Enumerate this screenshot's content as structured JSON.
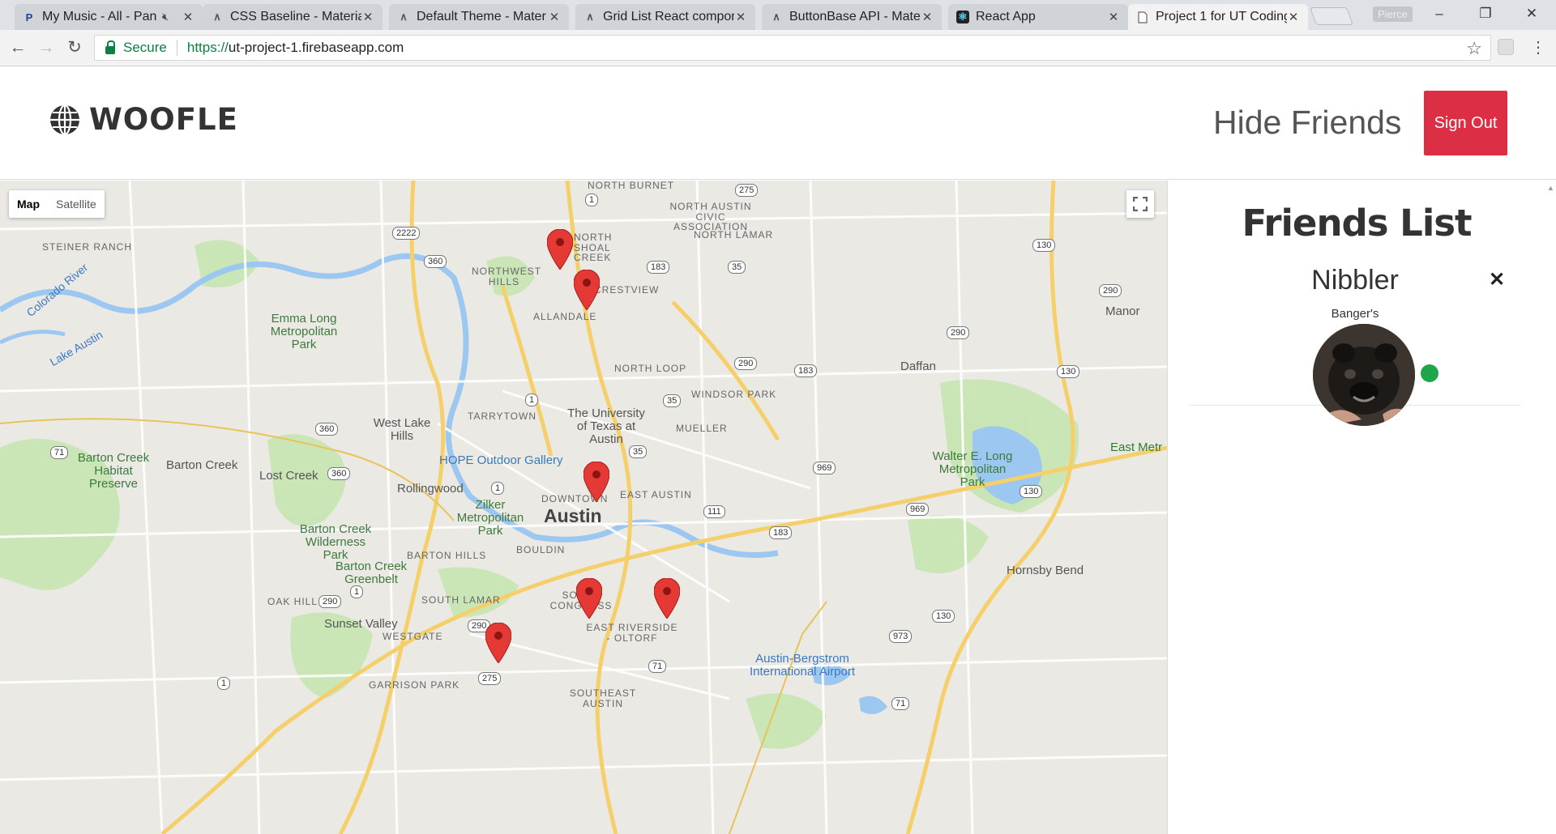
{
  "browser": {
    "tabs": [
      {
        "title": "My Music - All - Pan",
        "icon": "pandora-icon",
        "muted": true
      },
      {
        "title": "CSS Baseline - Material",
        "icon": "material-ui-icon"
      },
      {
        "title": "Default Theme - Mater",
        "icon": "material-ui-icon"
      },
      {
        "title": "Grid List React compon",
        "icon": "material-ui-icon"
      },
      {
        "title": "ButtonBase API - Mater",
        "icon": "material-ui-icon"
      },
      {
        "title": "React App",
        "icon": "react-icon"
      },
      {
        "title": "Project 1 for UT Coding",
        "icon": "page-icon",
        "active": true
      }
    ],
    "profile_name": "Pierce",
    "secure_label": "Secure",
    "url_scheme": "https://",
    "url_host": "ut-project-1.firebaseapp.com"
  },
  "header": {
    "logo_text": "WOOFLE",
    "hide_friends_label": "Hide Friends",
    "sign_out_label": "Sign Out",
    "accent_color": "#dc2f45"
  },
  "map": {
    "type_options": [
      "Map",
      "Satellite"
    ],
    "selected_type": "Map",
    "labels": {
      "north_burnet": "NORTH BURNET",
      "north_austin_civic": "NORTH AUSTIN CIVIC ASSOCIATION",
      "north_lamar": "NORTH LAMAR",
      "north_shoal_creek": "NORTH SHOAL CREEK",
      "steiner_ranch": "STEINER RANCH",
      "northwest_hills": "NORTHWEST HILLS",
      "crestview": "CRESTVIEW",
      "allandale": "ALLANDALE",
      "emma_long": "Emma Long Metropolitan Park",
      "colorado_river": "Colorado River",
      "lake_austin": "Lake Austin",
      "north_loop": "NORTH LOOP",
      "windsor_park": "WINDSOR PARK",
      "daffan": "Daffan",
      "manor": "Manor",
      "tarrytown": "TARRYTOWN",
      "ut_austin": "The University of Texas at Austin",
      "mueller": "MUELLER",
      "west_lake_hills": "West Lake Hills",
      "barton_creek_habitat": "Barton Creek Habitat Preserve",
      "barton_creek": "Barton Creek",
      "lost_creek": "Lost Creek",
      "hope_gallery": "HOPE Outdoor Gallery",
      "rollingwood": "Rollingwood",
      "zilker": "Zilker Metropolitan Park",
      "downtown": "DOWNTOWN",
      "austin": "Austin",
      "east_austin": "EAST AUSTIN",
      "walter_long": "Walter E. Long Metropolitan Park",
      "east_metro": "East Metr",
      "barton_wilderness": "Barton Creek Wilderness Park",
      "barton_hills": "BARTON HILLS",
      "bouldin": "BOULDIN",
      "barton_greenbelt": "Barton Creek Greenbelt",
      "oak_hill": "OAK HILL",
      "south_lamar": "SOUTH LAMAR",
      "south_congress": "SOUTH CONGRESS",
      "sunset_valley": "Sunset Valley",
      "westgate": "WESTGATE",
      "east_riverside": "EAST RIVERSIDE - OLTORF",
      "hornsby_bend": "Hornsby Bend",
      "airport": "Austin-Bergstrom International Airport",
      "garrison_park": "GARRISON PARK",
      "southeast_austin": "SOUTHEAST AUSTIN"
    },
    "route_shields": [
      "275",
      "1",
      "2222",
      "360",
      "183",
      "35",
      "130",
      "290",
      "290",
      "290",
      "183",
      "35",
      "130",
      "1",
      "35",
      "360",
      "71",
      "360",
      "969",
      "1",
      "111",
      "969",
      "183",
      "130",
      "1",
      "290",
      "290",
      "130",
      "973",
      "71",
      "275",
      "1",
      "71"
    ],
    "pin_color": "#e53935",
    "marker_count": 7
  },
  "friends_panel": {
    "title": "Friends List",
    "friends": [
      {
        "name": "Nibbler",
        "subtitle": "Banger's",
        "online": true
      }
    ],
    "online_color": "#1fa64a"
  }
}
